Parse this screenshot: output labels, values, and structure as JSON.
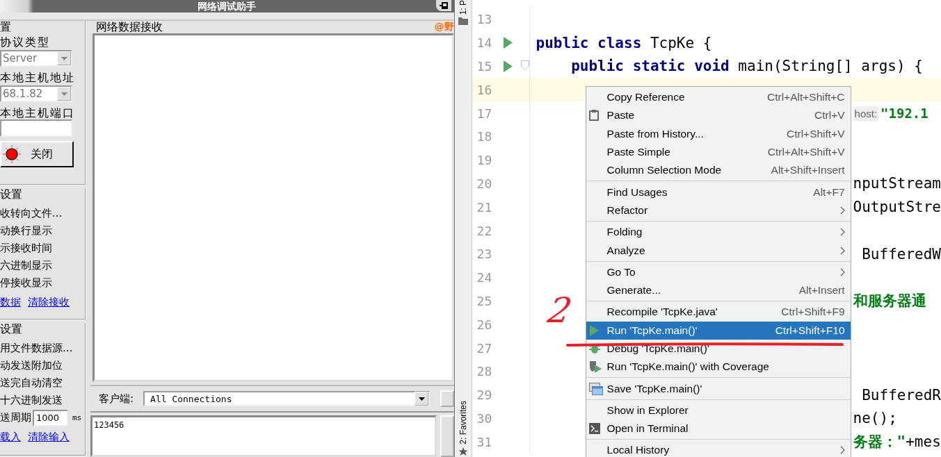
{
  "debug_window": {
    "title": "网络调试助手",
    "network_settings": {
      "legend": "置",
      "protocol_label": "协议类型",
      "protocol_value": "Server",
      "host_label": "本地主机地址",
      "host_value": "68.1.82",
      "port_label": "本地主机端口",
      "connect_button": "关闭"
    },
    "receive_settings": {
      "legend": "设置",
      "options": [
        "收转向文件...",
        "动换行显示",
        "示接收时间",
        "六进制显示",
        "停接收显示"
      ],
      "links": [
        "数据",
        "清除接收"
      ]
    },
    "send_settings": {
      "legend": "设置",
      "options": [
        "用文件数据源...",
        "动发送附加位",
        "送完自动清空",
        "十六进制发送"
      ],
      "period_label": "送周期",
      "period_value": "1000",
      "period_unit": "ms",
      "links": [
        "载入",
        "清除输入"
      ]
    },
    "receive_area": {
      "legend": "网络数据接收",
      "brand_text": "@野"
    },
    "client_label": "客户端:",
    "client_value": "All Connections",
    "send_text": "123456"
  },
  "ide": {
    "tool_tabs": [
      "1: P",
      "2: Favorites"
    ],
    "lines": [
      {
        "number": "13",
        "run_marker": false,
        "fold_marker": false,
        "current": false,
        "kind": "full"
      },
      {
        "number": "14",
        "run_marker": true,
        "fold_marker": false,
        "current": false,
        "kind": "full",
        "segments": [
          {
            "kind": "keyword",
            "text": "public class"
          },
          {
            "kind": "plain",
            "text": " TcpKe {"
          }
        ]
      },
      {
        "number": "15",
        "run_marker": true,
        "fold_marker": true,
        "current": false,
        "kind": "full",
        "segments": [
          {
            "kind": "keyword",
            "text": "    public static void"
          },
          {
            "kind": "plain",
            "text": " main(String[] args) {"
          }
        ]
      },
      {
        "number": "16",
        "run_marker": false,
        "fold_marker": false,
        "current": true,
        "kind": "full"
      },
      {
        "number": "17",
        "run_marker": false,
        "fold_marker": false,
        "current": false,
        "kind": "tail",
        "segments": [
          {
            "kind": "hint",
            "text": "host:"
          },
          {
            "kind": "string",
            "text": "\"192.1"
          }
        ]
      },
      {
        "number": "18",
        "run_marker": false,
        "fold_marker": false,
        "current": false,
        "kind": "full"
      },
      {
        "number": "19",
        "run_marker": false,
        "fold_marker": false,
        "current": false,
        "kind": "full"
      },
      {
        "number": "20",
        "run_marker": false,
        "fold_marker": false,
        "current": false,
        "kind": "tail",
        "segments": [
          {
            "kind": "plain",
            "text": "nputStream"
          }
        ]
      },
      {
        "number": "21",
        "run_marker": false,
        "fold_marker": false,
        "current": false,
        "kind": "tail",
        "segments": [
          {
            "kind": "plain",
            "text": "OutputStre"
          }
        ]
      },
      {
        "number": "22",
        "run_marker": false,
        "fold_marker": false,
        "current": false,
        "kind": "full"
      },
      {
        "number": "23",
        "run_marker": false,
        "fold_marker": false,
        "current": false,
        "kind": "tail",
        "segments": [
          {
            "kind": "plain",
            "text": " BufferedW"
          }
        ]
      },
      {
        "number": "24",
        "run_marker": false,
        "fold_marker": false,
        "current": false,
        "kind": "full"
      },
      {
        "number": "25",
        "run_marker": false,
        "fold_marker": false,
        "current": false,
        "kind": "tail",
        "segments": [
          {
            "kind": "string",
            "text": "和服务器通"
          }
        ]
      },
      {
        "number": "26",
        "run_marker": false,
        "fold_marker": false,
        "current": false,
        "kind": "full"
      },
      {
        "number": "27",
        "run_marker": false,
        "fold_marker": false,
        "current": false,
        "kind": "full"
      },
      {
        "number": "28",
        "run_marker": false,
        "fold_marker": false,
        "current": false,
        "kind": "full"
      },
      {
        "number": "29",
        "run_marker": false,
        "fold_marker": false,
        "current": false,
        "kind": "tail",
        "segments": [
          {
            "kind": "plain",
            "text": " BufferedR"
          }
        ]
      },
      {
        "number": "30",
        "run_marker": false,
        "fold_marker": false,
        "current": false,
        "kind": "tail",
        "segments": [
          {
            "kind": "plain",
            "text": "ne();"
          }
        ]
      },
      {
        "number": "31",
        "run_marker": false,
        "fold_marker": false,
        "current": false,
        "kind": "tail",
        "segments": [
          {
            "kind": "string",
            "text": "务器：\""
          },
          {
            "kind": "plain",
            "text": "+mes"
          }
        ]
      }
    ],
    "context_menu": {
      "items": [
        {
          "kind": "item",
          "label": "Copy Reference",
          "shortcut": "Ctrl+Alt+Shift+C",
          "submenu": false,
          "selected": false
        },
        {
          "kind": "paste",
          "label": "Paste",
          "shortcut": "Ctrl+V",
          "submenu": false,
          "selected": false
        },
        {
          "kind": "item",
          "label": "Paste from History...",
          "shortcut": "Ctrl+Shift+V",
          "submenu": false,
          "selected": false
        },
        {
          "kind": "item",
          "label": "Paste Simple",
          "shortcut": "Ctrl+Alt+Shift+V",
          "submenu": false,
          "selected": false
        },
        {
          "kind": "item",
          "label": "Column Selection Mode",
          "shortcut": "Alt+Shift+Insert",
          "submenu": false,
          "selected": false
        },
        {
          "kind": "separator"
        },
        {
          "kind": "item",
          "label": "Find Usages",
          "shortcut": "Alt+F7",
          "submenu": false,
          "selected": false
        },
        {
          "kind": "item",
          "label": "Refactor",
          "submenu": true,
          "selected": false
        },
        {
          "kind": "separator"
        },
        {
          "kind": "item",
          "label": "Folding",
          "submenu": true,
          "selected": false
        },
        {
          "kind": "item",
          "label": "Analyze",
          "submenu": true,
          "selected": false
        },
        {
          "kind": "separator"
        },
        {
          "kind": "item",
          "label": "Go To",
          "submenu": true,
          "selected": false
        },
        {
          "kind": "item",
          "label": "Generate...",
          "shortcut": "Alt+Insert",
          "submenu": false,
          "selected": false
        },
        {
          "kind": "separator"
        },
        {
          "kind": "item",
          "label": "Recompile 'TcpKe.java'",
          "shortcut": "Ctrl+Shift+F9",
          "submenu": false,
          "selected": false
        },
        {
          "kind": "run",
          "label": "Run 'TcpKe.main()'",
          "shortcut": "Ctrl+Shift+F10",
          "submenu": false,
          "selected": true
        },
        {
          "kind": "debug",
          "label": "Debug 'TcpKe.main()'",
          "submenu": false,
          "selected": false
        },
        {
          "kind": "coverage",
          "label": "Run 'TcpKe.main()' with Coverage",
          "submenu": false,
          "selected": false
        },
        {
          "kind": "separator"
        },
        {
          "kind": "save",
          "label": "Save 'TcpKe.main()'",
          "submenu": false,
          "selected": false
        },
        {
          "kind": "separator"
        },
        {
          "kind": "item",
          "label": "Show in Explorer",
          "submenu": false,
          "selected": false
        },
        {
          "kind": "terminal",
          "label": "Open in Terminal",
          "submenu": false,
          "selected": false
        },
        {
          "kind": "separator"
        },
        {
          "kind": "item",
          "label": "Local History",
          "submenu": true,
          "selected": false
        }
      ]
    },
    "annotation": {
      "mark": "2"
    }
  }
}
